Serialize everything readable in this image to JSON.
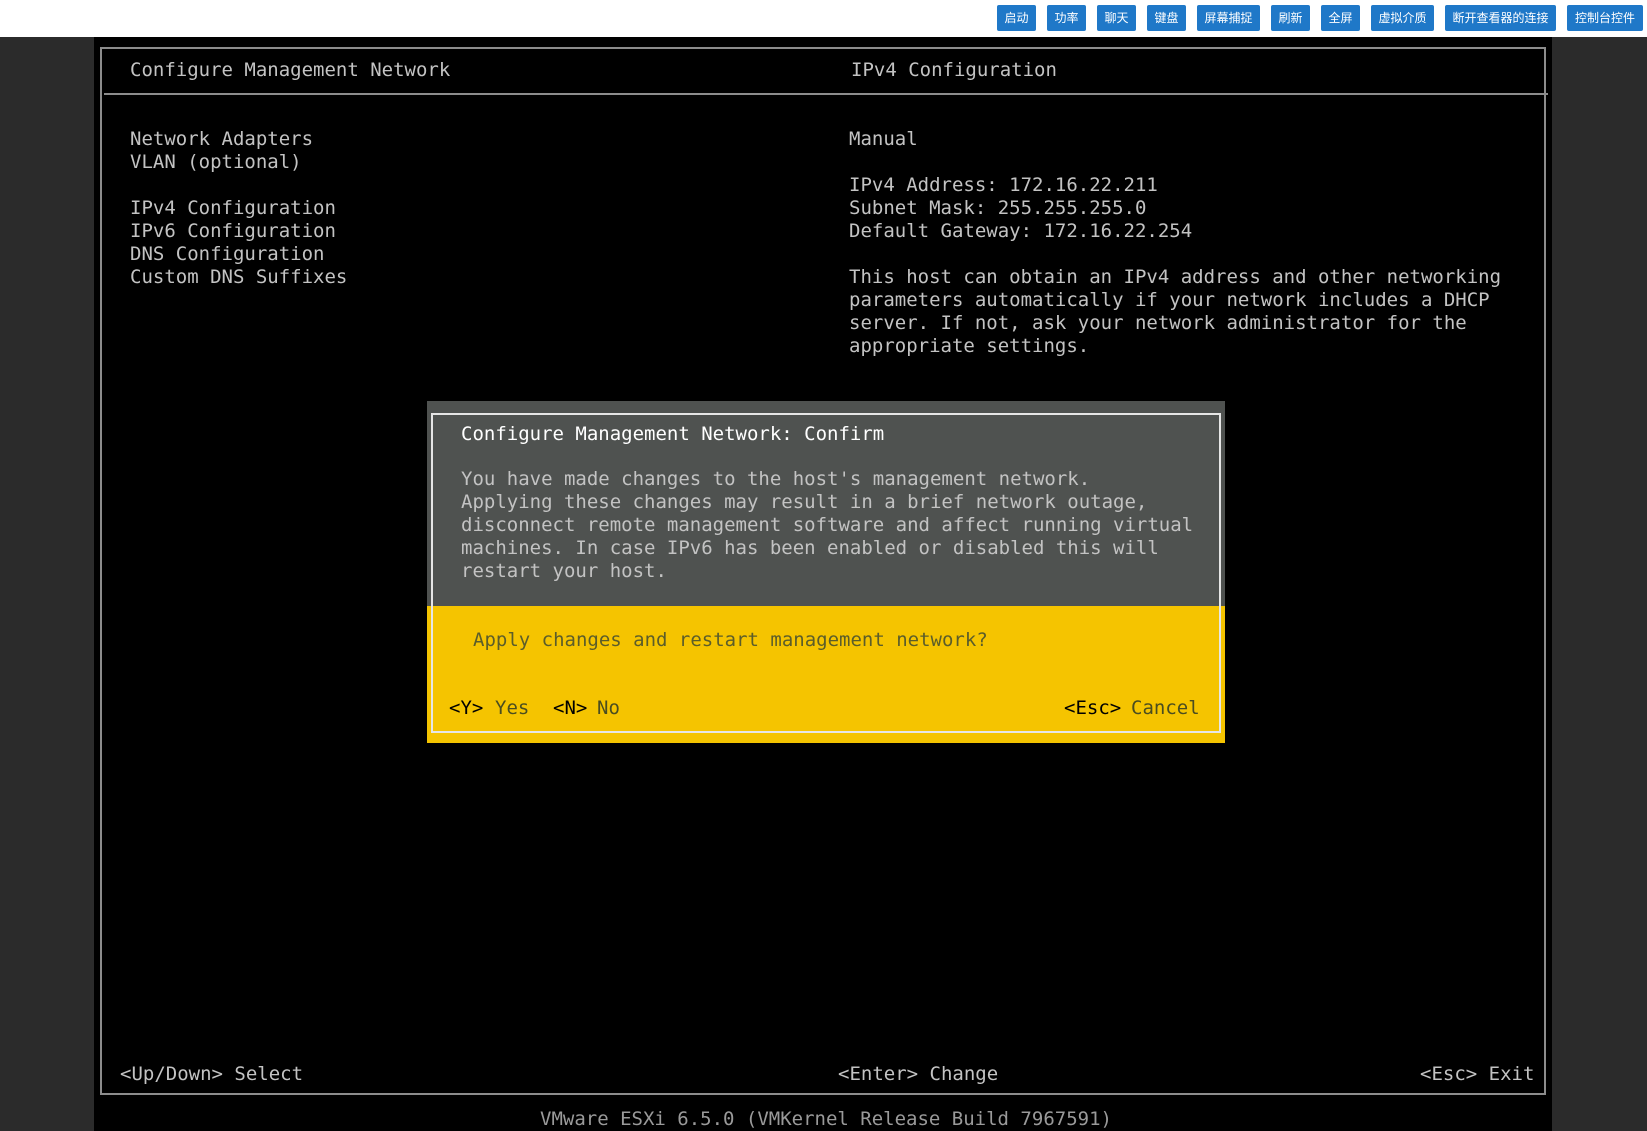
{
  "toolbar": {
    "buttons": [
      "启动",
      "功率",
      "聊天",
      "键盘",
      "屏幕捕捉",
      "刷新",
      "全屏",
      "虚拟介质",
      "断开查看器的连接",
      "控制台控件"
    ]
  },
  "console": {
    "left_title": "Configure Management Network",
    "right_title": "IPv4 Configuration",
    "menu": [
      "Network Adapters",
      "VLAN (optional)",
      "IPv4 Configuration",
      "IPv6 Configuration",
      "DNS Configuration",
      "Custom DNS Suffixes"
    ],
    "mode": "Manual",
    "ipv4_address": "IPv4 Address: 172.16.22.211",
    "subnet_mask": "Subnet Mask: 255.255.255.0",
    "default_gateway": "Default Gateway: 172.16.22.254",
    "description": [
      "This host can obtain an IPv4 address and other networking",
      "parameters automatically if your network includes a DHCP",
      "server. If not, ask your network administrator for the",
      "appropriate settings."
    ],
    "footer_left": "<Up/Down> Select",
    "footer_center": "<Enter> Change",
    "footer_right": "<Esc> Exit",
    "status_line": "VMware ESXi 6.5.0 (VMKernel Release Build 7967591)"
  },
  "dialog": {
    "title": "Configure Management Network: Confirm",
    "message": [
      "You have made changes to the host's management network.",
      "Applying these changes may result in a brief network outage,",
      "disconnect remote management software and affect running virtual",
      "machines. In case IPv6 has been enabled or disabled this will",
      "restart your host."
    ],
    "question": "Apply changes and restart management network?",
    "yes_key": "<Y>",
    "yes_label": "Yes",
    "no_key": "<N>",
    "no_label": "No",
    "cancel_key": "<Esc>",
    "cancel_label": "Cancel"
  },
  "colors": {
    "toolbar_button": "#1f78c8",
    "dialog_bg": "#4f5250",
    "dialog_highlight": "#f5c400",
    "console_bg": "#000000"
  }
}
